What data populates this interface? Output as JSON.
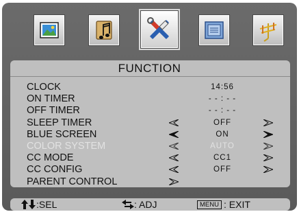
{
  "tabs": [
    {
      "icon": "picture-icon",
      "active": false
    },
    {
      "icon": "music-note-icon",
      "active": false
    },
    {
      "icon": "tools-icon",
      "active": true
    },
    {
      "icon": "screen-icon",
      "active": false
    },
    {
      "icon": "antenna-icon",
      "active": false
    }
  ],
  "panel": {
    "title": "FUNCTION",
    "items": [
      {
        "label": "CLOCK",
        "value": "14:56",
        "left_arrow": false,
        "right_arrow": false,
        "state": "normal"
      },
      {
        "label": "ON TIMER",
        "value": "- - : - -",
        "left_arrow": false,
        "right_arrow": false,
        "state": "normal"
      },
      {
        "label": "OFF TIMER",
        "value": "- - : - -",
        "left_arrow": false,
        "right_arrow": false,
        "state": "normal"
      },
      {
        "label": "SLEEP TIMER",
        "value": "OFF",
        "left_arrow": true,
        "right_arrow": true,
        "state": "normal"
      },
      {
        "label": "BLUE SCREEN",
        "value": "ON",
        "left_arrow": true,
        "right_arrow": true,
        "state": "selected"
      },
      {
        "label": "COLOR SYSTEM",
        "value": "AUTO",
        "left_arrow": true,
        "right_arrow": true,
        "state": "disabled"
      },
      {
        "label": "CC MODE",
        "value": "CC1",
        "left_arrow": true,
        "right_arrow": true,
        "state": "normal"
      },
      {
        "label": "CC CONFIG",
        "value": "OFF",
        "left_arrow": true,
        "right_arrow": true,
        "state": "normal"
      },
      {
        "label": "PARENT CONTROL",
        "value": "",
        "left_arrow": true,
        "right_arrow": false,
        "state": "submenu"
      }
    ]
  },
  "footer": {
    "select_hint": ":SEL",
    "adjust_hint": ": ADJ",
    "menu_key": "MENU",
    "exit_hint": ": EXIT"
  },
  "colors": {
    "osd_background": "#5f5f5f",
    "panel_background": "#bfbfbf",
    "disabled_text": "#e2e2e2"
  }
}
